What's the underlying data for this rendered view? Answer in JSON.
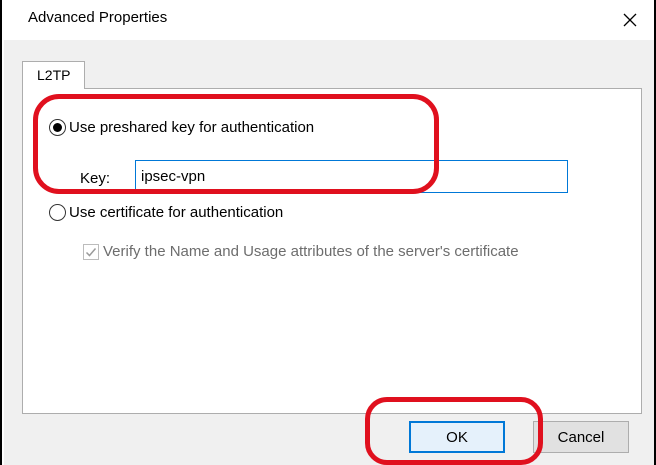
{
  "window": {
    "title": "Advanced Properties",
    "close_glyph": "✕"
  },
  "tabs": [
    {
      "label": "L2TP",
      "selected": true
    }
  ],
  "auth": {
    "preshared_label": "Use preshared key for authentication",
    "preshared_selected": true,
    "key_label": "Key:",
    "key_value": "ipsec-vpn",
    "certificate_label": "Use certificate for authentication",
    "certificate_selected": false,
    "verify_label": "Verify the Name and Usage attributes of the server's certificate",
    "verify_checked": true,
    "verify_enabled": false
  },
  "buttons": {
    "ok_label": "OK",
    "cancel_label": "Cancel"
  },
  "colors": {
    "annotation": "#e0101e",
    "focus_blue": "#0078d7",
    "disabled_text": "#6d6d6d"
  }
}
